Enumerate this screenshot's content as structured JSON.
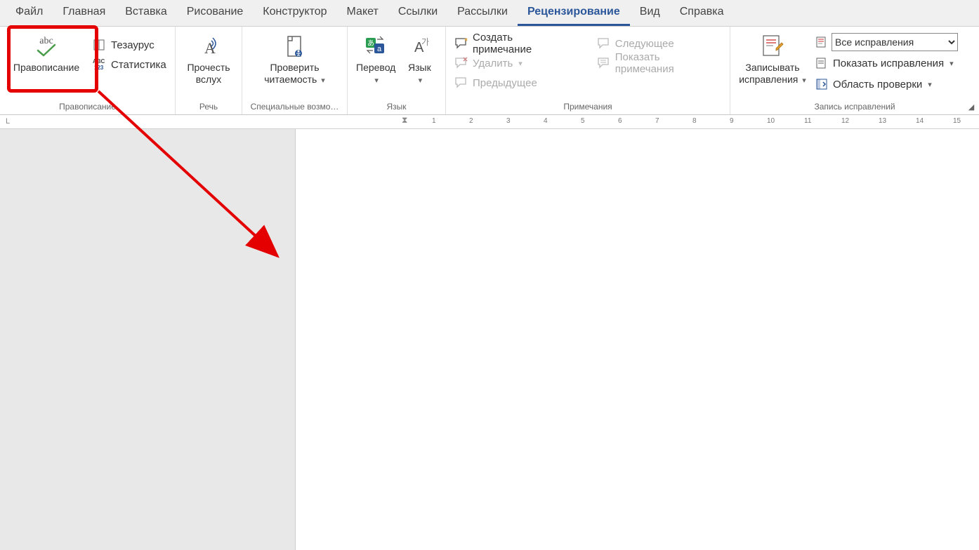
{
  "tabs": {
    "items": [
      "Файл",
      "Главная",
      "Вставка",
      "Рисование",
      "Конструктор",
      "Макет",
      "Ссылки",
      "Рассылки",
      "Рецензирование",
      "Вид",
      "Справка"
    ],
    "active_index": 8
  },
  "ribbon": {
    "spelling_group": {
      "label": "Правописание",
      "spelling": "Правописание",
      "thesaurus": "Тезаурус",
      "statistics": "Статистика"
    },
    "speech_group": {
      "label": "Речь",
      "read_aloud_l1": "Прочесть",
      "read_aloud_l2": "вслух"
    },
    "accessibility_group": {
      "label": "Специальные возмо…",
      "check_l1": "Проверить",
      "check_l2": "читаемость"
    },
    "language_group": {
      "label": "Язык",
      "translate": "Перевод",
      "language": "Язык"
    },
    "comments_group": {
      "label": "Примечания",
      "new_comment": "Создать примечание",
      "delete": "Удалить",
      "previous": "Предыдущее",
      "next": "Следующее",
      "show_comments": "Показать примечания"
    },
    "tracking_group": {
      "label": "Запись исправлений",
      "track_l1": "Записывать",
      "track_l2": "исправления",
      "display_combo": "Все исправления",
      "show_markup": "Показать исправления",
      "reviewing_pane": "Область проверки"
    }
  },
  "ruler": {
    "numbers": [
      "1",
      "2",
      "3",
      "4",
      "5",
      "6",
      "7",
      "8",
      "9",
      "10",
      "11",
      "12",
      "13",
      "14",
      "15"
    ]
  }
}
